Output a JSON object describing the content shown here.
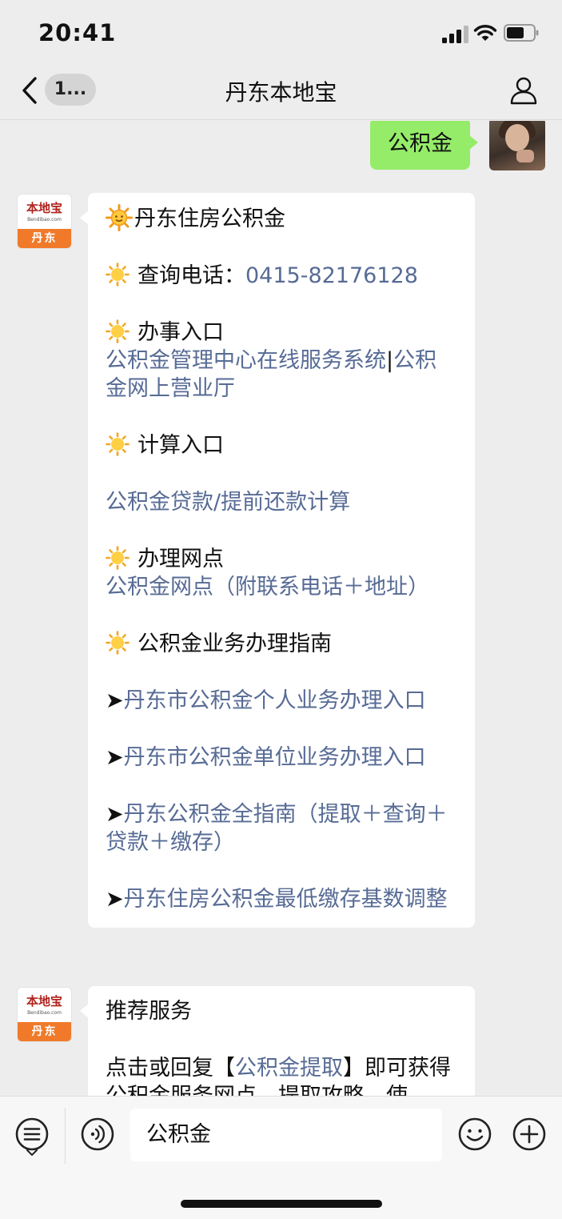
{
  "status_bar": {
    "time": "20:41"
  },
  "nav": {
    "back_badge": "1...",
    "title": "丹东本地宝"
  },
  "outgoing_message": {
    "text": "公积金"
  },
  "bot": {
    "logo_text": "本地宝",
    "logo_sub": "Bendibao.com",
    "logo_city": "丹东"
  },
  "message1": {
    "title": "丹东住房公积金",
    "phone_label": "查询电话：",
    "phone_number": "0415-82176128",
    "section1_title": "办事入口",
    "section1_link_a": "公积金管理中心在线服务系统",
    "section1_sep": "|",
    "section1_link_b": "公积金网上营业厅",
    "section2_title": "计算入口",
    "section2_link": "公积金贷款/提前还款计算",
    "section3_title": "办理网点",
    "section3_link": "公积金网点（附联系电话＋地址）",
    "section4_title": "公积金业务办理指南",
    "arrow": "➤",
    "guide1": "丹东市公积金个人业务办理入口",
    "guide2": "丹东市公积金单位业务办理入口",
    "guide3": "丹东公积金全指南（提取＋查询＋贷款＋缴存）",
    "guide4": "丹东住房公积金最低缴存基数调整"
  },
  "message2": {
    "title": "推荐服务",
    "text_before": "点击或回复【",
    "link": "公积金提取",
    "text_after": "】即可获得公积金服务网点、提取攻略、使"
  },
  "input_bar": {
    "value": "公积金"
  },
  "icons": {
    "back": "chevron-left-icon",
    "profile": "person-icon",
    "menu": "keyboard-menu-icon",
    "voice": "voice-icon",
    "emoji": "emoji-icon",
    "plus": "plus-icon"
  },
  "colors": {
    "link": "#576b95",
    "outgoing_bubble": "#95ec69",
    "background": "#ededed",
    "brand_orange": "#f07a2a"
  }
}
